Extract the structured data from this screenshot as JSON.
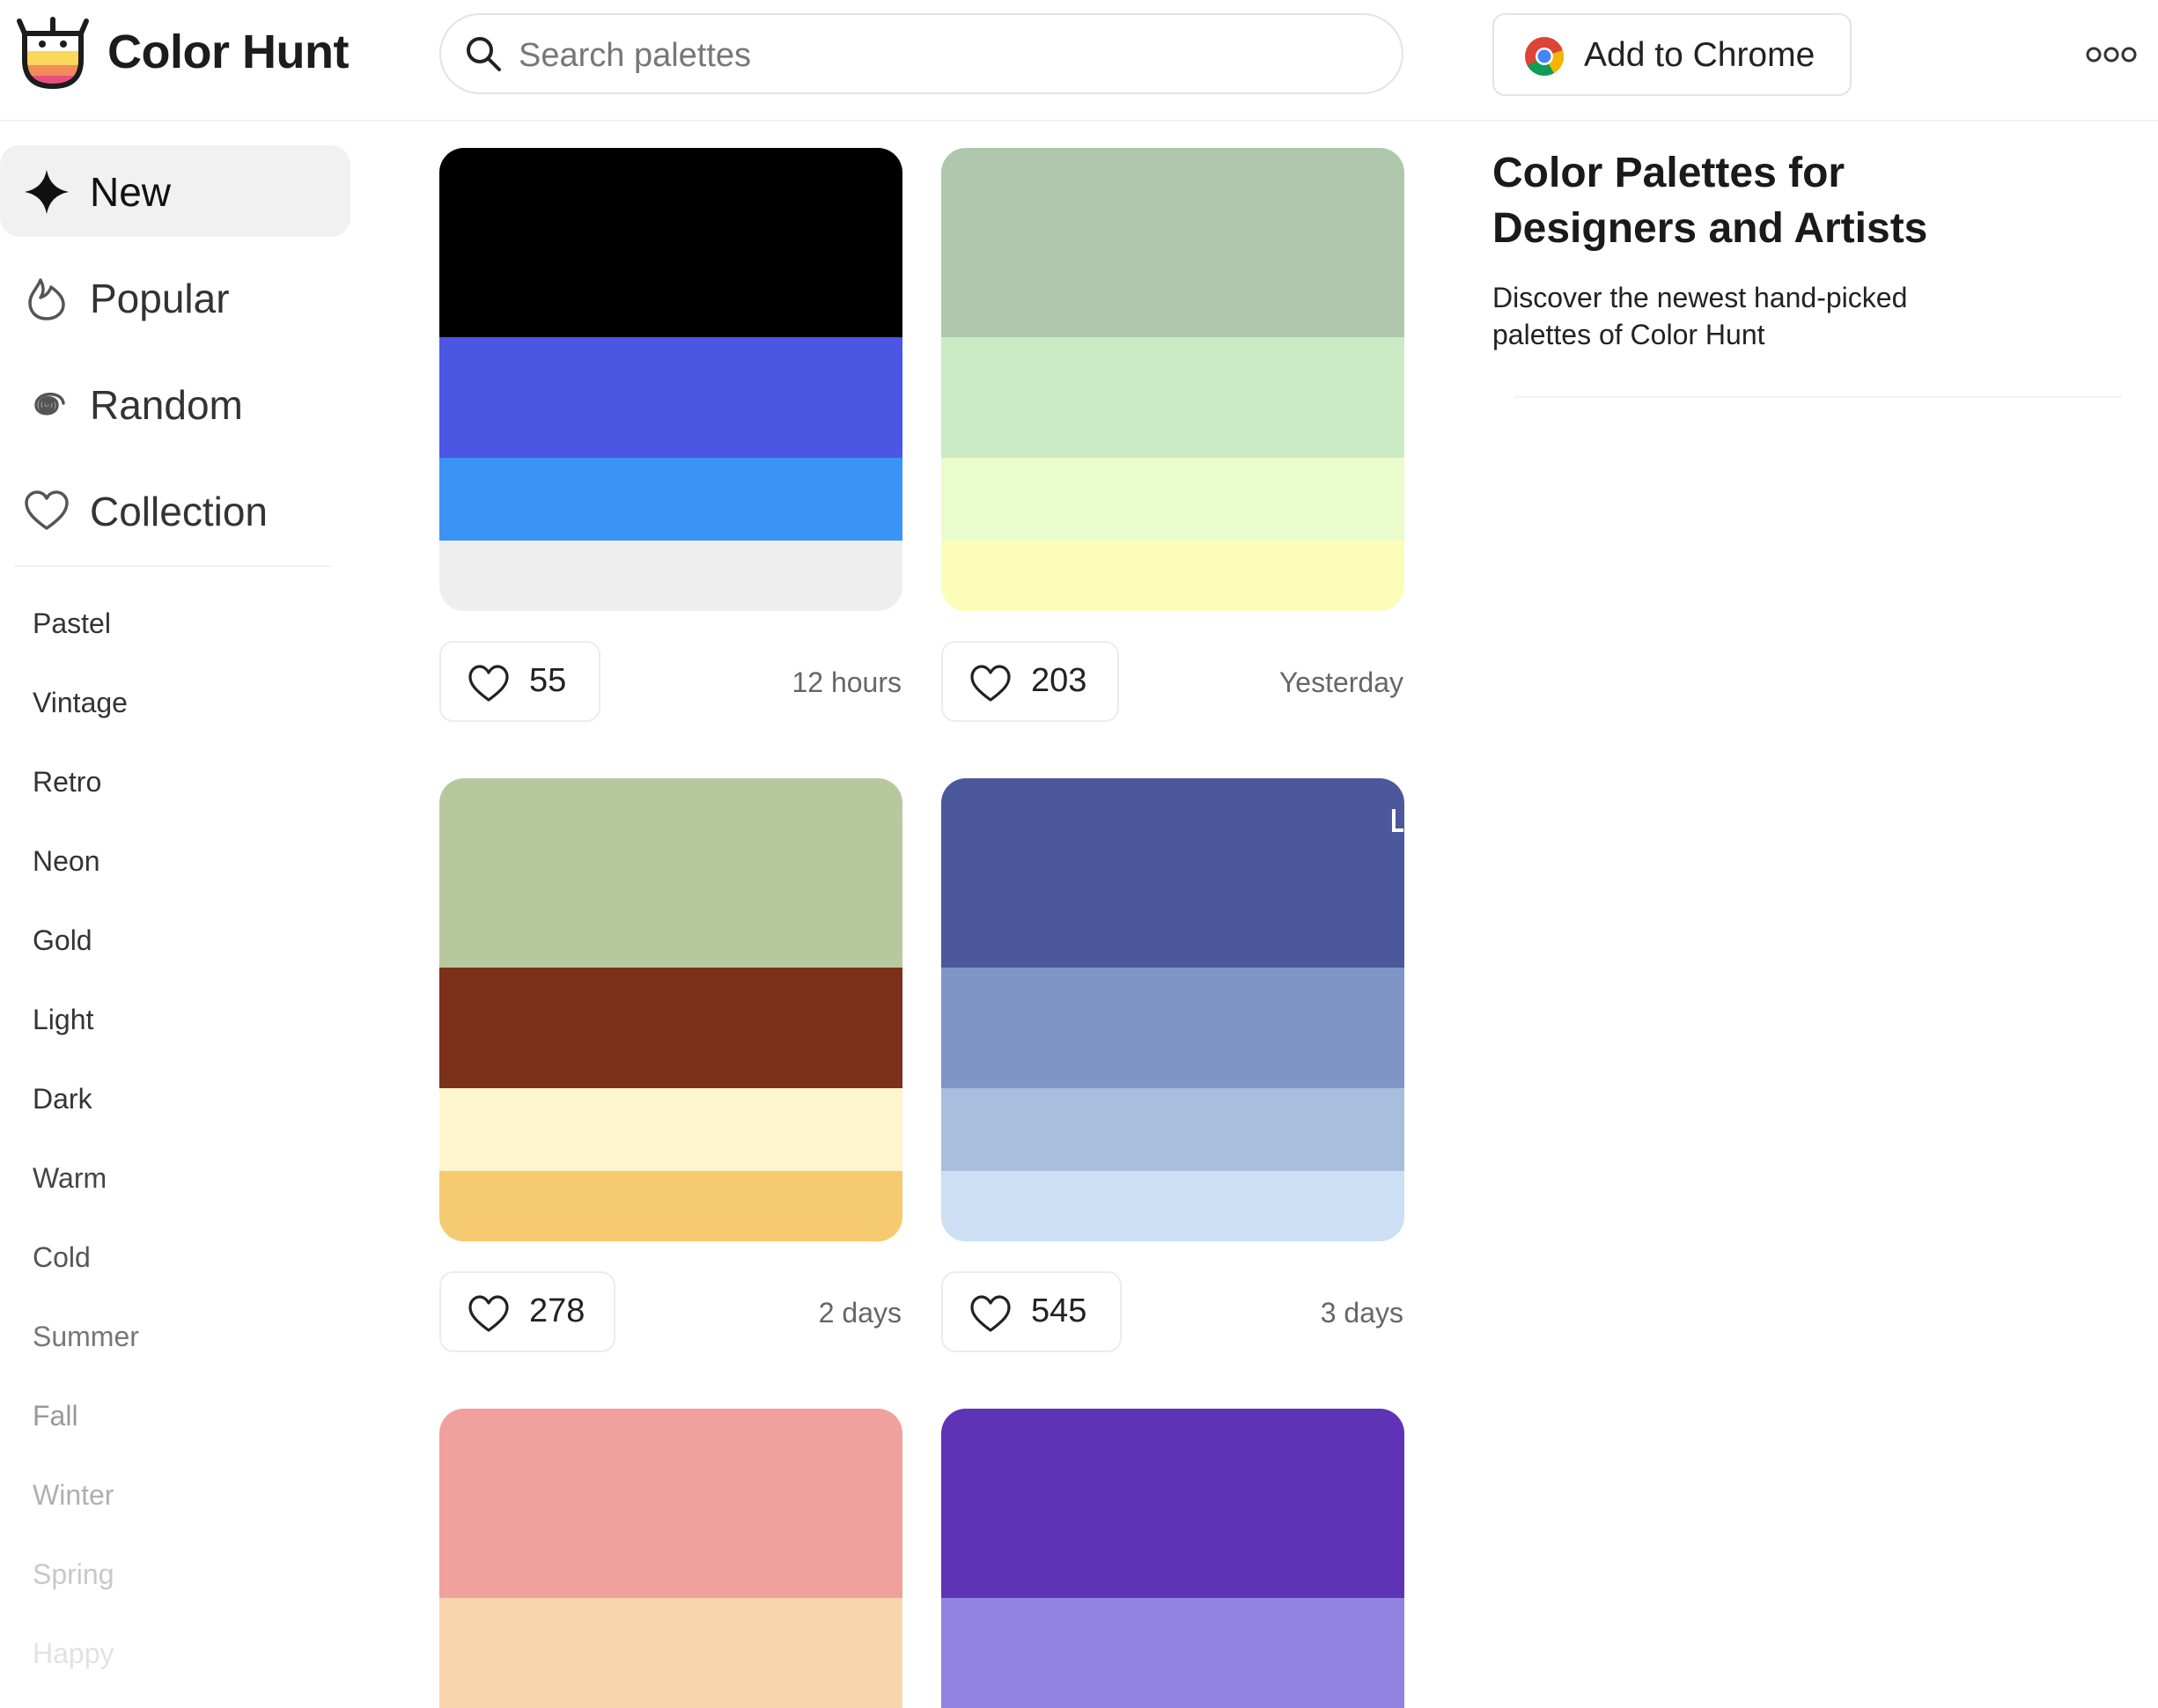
{
  "header": {
    "brand": "Color Hunt",
    "search_placeholder": "Search palettes",
    "chrome_button": "Add to Chrome"
  },
  "icons": {
    "logo": "color-hunt-logo",
    "search": "search-icon",
    "chrome": "chrome-icon",
    "more": "more-icon",
    "heart": "heart-icon"
  },
  "sidebar": {
    "nav": [
      {
        "label": "New",
        "icon": "sparkle-icon",
        "active": true
      },
      {
        "label": "Popular",
        "icon": "flame-icon",
        "active": false
      },
      {
        "label": "Random",
        "icon": "spiral-icon",
        "active": false
      },
      {
        "label": "Collection",
        "icon": "heart-icon",
        "active": false
      }
    ],
    "tags": [
      "Pastel",
      "Vintage",
      "Retro",
      "Neon",
      "Gold",
      "Light",
      "Dark",
      "Warm",
      "Cold",
      "Summer",
      "Fall",
      "Winter",
      "Spring",
      "Happy"
    ]
  },
  "palettes": [
    {
      "colors": [
        "#000000",
        "#4B56E2",
        "#3B93F6",
        "#EEEEEE"
      ],
      "likes": "55",
      "time": "12 hours"
    },
    {
      "colors": [
        "#AFC8AD",
        "#CBEBC5",
        "#EAFCCB",
        "#FDFDBA"
      ],
      "likes": "203",
      "time": "Yesterday"
    },
    {
      "colors": [
        "#B8C89E",
        "#7B3019",
        "#FCF5CE",
        "#F6CA70"
      ],
      "likes": "278",
      "time": "2 days"
    },
    {
      "colors": [
        "#4B589C",
        "#7E95C6",
        "#A7BEDC",
        "#CCDFF4"
      ],
      "likes": "545",
      "time": "3 days"
    },
    {
      "colors": [
        "#F0A19E",
        "#F7D6AE"
      ]
    },
    {
      "colors": [
        "#5E33B6",
        "#9283E2"
      ]
    }
  ],
  "panel": {
    "title": "Color Palettes for Designers and Artists",
    "description": "Discover the newest hand-picked palettes of Color Hunt"
  }
}
